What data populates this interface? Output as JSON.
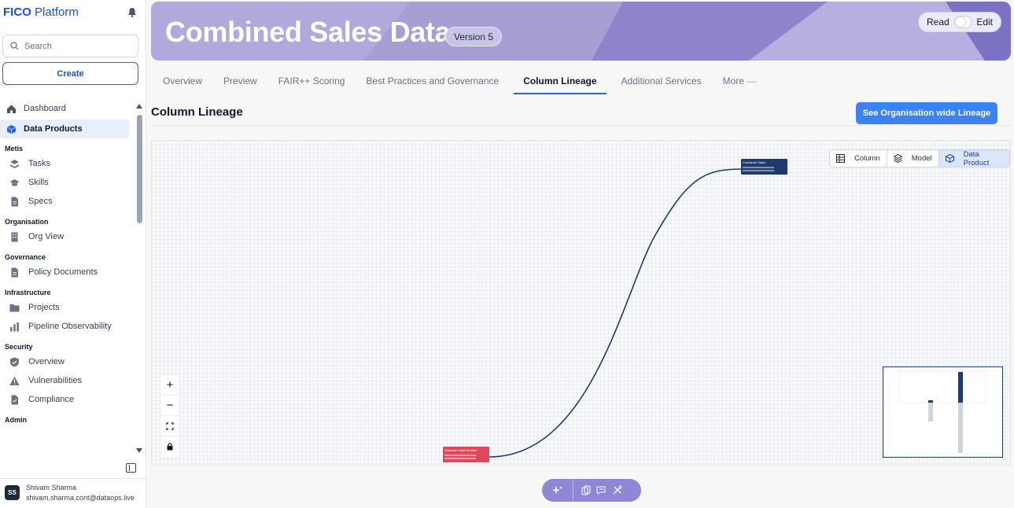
{
  "sidebar": {
    "brand_bold": "FICO",
    "brand_rest": " Platform",
    "search_placeholder": "Search",
    "create_label": "Create",
    "top_items": [
      {
        "label": "Dashboard",
        "icon": "home-icon"
      },
      {
        "label": "Data Products",
        "icon": "cube-icon",
        "active": true
      }
    ],
    "sections": [
      {
        "title": "Metis",
        "items": [
          {
            "label": "Tasks",
            "icon": "layers-icon"
          },
          {
            "label": "Skills",
            "icon": "graduation-cap-icon"
          },
          {
            "label": "Specs",
            "icon": "document-icon"
          }
        ]
      },
      {
        "title": "Organisation",
        "items": [
          {
            "label": "Org View",
            "icon": "building-icon"
          }
        ]
      },
      {
        "title": "Governance",
        "items": [
          {
            "label": "Policy Documents",
            "icon": "document-icon"
          }
        ]
      },
      {
        "title": "Infrastructure",
        "items": [
          {
            "label": "Projects",
            "icon": "folder-icon"
          },
          {
            "label": "Pipeline Observability",
            "icon": "bar-chart-icon"
          }
        ]
      },
      {
        "title": "Security",
        "items": [
          {
            "label": "Overview",
            "icon": "shield-check-icon"
          },
          {
            "label": "Vulnerabilities",
            "icon": "warning-icon"
          },
          {
            "label": "Compliance",
            "icon": "document-check-icon"
          }
        ]
      },
      {
        "title": "Admin",
        "items": []
      }
    ],
    "user": {
      "initials": "SS",
      "name": "Shivam Sharma",
      "email": "shivam.sharma.cont@dataops.live"
    }
  },
  "header": {
    "title": "Combined Sales Data",
    "version": "Version 5",
    "mode_read": "Read",
    "mode_edit": "Edit",
    "mode": "read"
  },
  "tabs": [
    {
      "label": "Overview",
      "active": false
    },
    {
      "label": "Preview",
      "active": false
    },
    {
      "label": "FAIR++ Scoring",
      "active": false
    },
    {
      "label": "Best Practices and Governance",
      "active": false
    },
    {
      "label": "Column Lineage",
      "active": true
    },
    {
      "label": "Additional Services",
      "active": false
    },
    {
      "label": "More",
      "active": false
    }
  ],
  "lineage": {
    "title": "Column Lineage",
    "org_button": "See Organisation wide Lineage",
    "view_options": [
      {
        "label": "Column",
        "icon": "table-icon",
        "active": false
      },
      {
        "label": "Model",
        "icon": "stack-icon",
        "active": false
      },
      {
        "label": "Data Product",
        "icon": "cube-icon",
        "active": true
      }
    ],
    "target_node": {
      "title": "Combined Sales",
      "color": "#1e3a6e"
    },
    "source_node": {
      "title": "Unknown Data Product",
      "color": "#e0475b"
    },
    "edge_color": "#1e3a6e",
    "zoom_controls": [
      "+",
      "−"
    ]
  },
  "colors": {
    "accent": "#2563eb",
    "banner": "#a79fd3",
    "assistant": "#8f86d6"
  }
}
